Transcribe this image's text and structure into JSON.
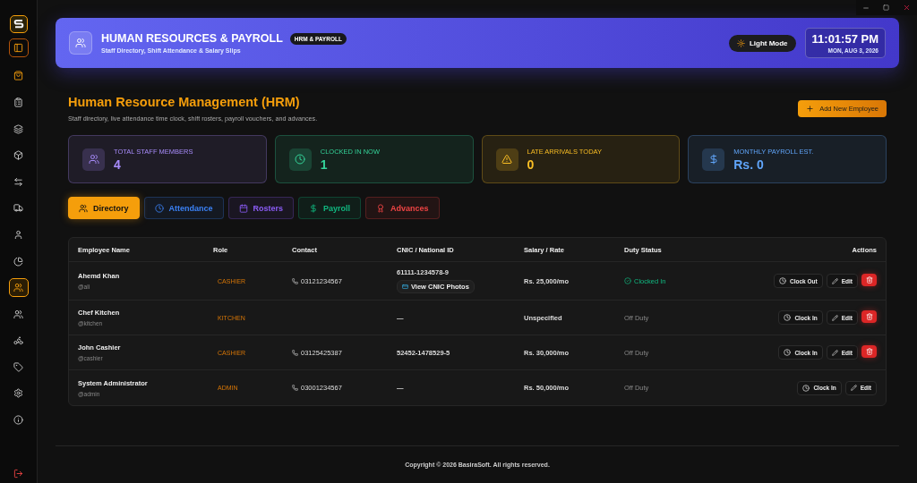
{
  "sidebar": {
    "items": [
      {
        "kind": "bag",
        "selected": false
      },
      {
        "kind": "clipboard",
        "selected": false
      },
      {
        "kind": "layers",
        "selected": false
      },
      {
        "kind": "box",
        "selected": false
      },
      {
        "kind": "transfer",
        "selected": false
      },
      {
        "kind": "truck",
        "selected": false
      },
      {
        "kind": "user",
        "selected": false
      },
      {
        "kind": "pie",
        "selected": false
      },
      {
        "kind": "users",
        "selected": true
      },
      {
        "kind": "users",
        "selected": false
      },
      {
        "kind": "bike",
        "selected": false
      },
      {
        "kind": "tag",
        "selected": false
      },
      {
        "kind": "settings",
        "selected": false
      },
      {
        "kind": "info",
        "selected": false
      }
    ]
  },
  "header": {
    "title": "HUMAN RESOURCES & PAYROLL",
    "badge": "HRM & PAYROLL",
    "subtitle": "Staff Directory, Shift Attendance & Salary Slips",
    "theme_button": "Light Mode",
    "time": "11:01:57 PM",
    "date": "MON, AUG 3, 2026"
  },
  "page": {
    "title": "Human Resource Management (HRM)",
    "description": "Staff directory, live attendance time clock, shift rosters, payroll vouchers, and advances.",
    "add_button": "Add New Employee"
  },
  "stats": [
    {
      "kind": "users",
      "label": "TOTAL STAFF MEMBERS",
      "value": "4",
      "color": "#a78bfa"
    },
    {
      "kind": "clock",
      "label": "CLOCKED IN NOW",
      "value": "1",
      "color": "#34d399"
    },
    {
      "kind": "warning",
      "label": "LATE ARRIVALS TODAY",
      "value": "0",
      "color": "#fbbf24"
    },
    {
      "kind": "dollar",
      "label": "MONTHLY PAYROLL EST.",
      "value": "Rs. 0",
      "color": "#60a5fa"
    }
  ],
  "tabs": [
    {
      "kind": "users",
      "label": "Directory",
      "selected": true,
      "color": "#f59e0b"
    },
    {
      "kind": "clock",
      "label": "Attendance",
      "selected": false,
      "color": "#3b82f6"
    },
    {
      "kind": "calendar",
      "label": "Rosters",
      "selected": false,
      "color": "#8b5cf6"
    },
    {
      "kind": "dollar",
      "label": "Payroll",
      "selected": false,
      "color": "#10b981"
    },
    {
      "kind": "award",
      "label": "Advances",
      "selected": false,
      "color": "#ef4444"
    }
  ],
  "table": {
    "columns": [
      "Employee Name",
      "Role",
      "Contact",
      "CNIC / National ID",
      "Salary / Rate",
      "Duty Status",
      "Actions"
    ],
    "rows": [
      {
        "name": "Ahemd Khan",
        "handle": "@ali",
        "role": "CASHIER",
        "contact": "03121234567",
        "cnic": "61111-1234578-9",
        "cnic_action": "View CNIC Photos",
        "salary": "Rs. 25,000/mo",
        "status": {
          "kind": "clocked_in",
          "label": "Clocked In"
        },
        "clock_action": "Clock Out",
        "edit": "Edit",
        "deletable": true
      },
      {
        "name": "Chef Kitchen",
        "handle": "@kitchen",
        "role": "KITCHEN",
        "cnic": "—",
        "salary": "Unspecified",
        "status": {
          "kind": "off",
          "label": "Off Duty"
        },
        "clock_action": "Clock In",
        "edit": "Edit",
        "deletable": true
      },
      {
        "name": "John Cashier",
        "handle": "@cashier",
        "role": "CASHIER",
        "contact": "03125425387",
        "cnic": "52452-1478529-5",
        "salary": "Rs. 30,000/mo",
        "status": {
          "kind": "off",
          "label": "Off Duty"
        },
        "clock_action": "Clock In",
        "edit": "Edit",
        "deletable": true
      },
      {
        "name": "System Administrator",
        "handle": "@admin",
        "role": "ADMIN",
        "contact": "03001234567",
        "cnic": "—",
        "salary": "Rs. 50,000/mo",
        "status": {
          "kind": "off",
          "label": "Off Duty"
        },
        "clock_action": "Clock In",
        "edit": "Edit",
        "deletable": false
      }
    ]
  },
  "footer": "Copyright © 2026 BasiraSoft. All rights reserved."
}
